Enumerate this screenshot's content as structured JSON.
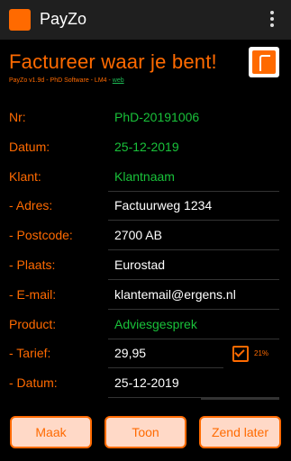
{
  "appbar": {
    "title": "PayZo"
  },
  "header": {
    "headline": "Factureer waar je bent!",
    "subline_prefix": "PayZo v1.9d - PhD Software - LM4 - ",
    "subline_link": "web"
  },
  "form": {
    "nr": {
      "label": "Nr:",
      "value": "PhD-20191006"
    },
    "datum": {
      "label": "Datum:",
      "value": "25-12-2019"
    },
    "klant": {
      "label": "Klant:",
      "value": "Klantnaam"
    },
    "adres": {
      "label": "- Adres:",
      "value": "Factuurweg 1234"
    },
    "postcode": {
      "label": "- Postcode:",
      "value": "2700 AB"
    },
    "plaats": {
      "label": "- Plaats:",
      "value": "Eurostad"
    },
    "email": {
      "label": "- E-mail:",
      "value": "klantemail@ergens.nl"
    },
    "product": {
      "label": "Product:",
      "value": "Adviesgesprek"
    },
    "tarief": {
      "label": "- Tarief:",
      "value": "29,95",
      "vat_label": "21%"
    },
    "datum2": {
      "label": "- Datum:",
      "value": "25-12-2019"
    }
  },
  "buttons": {
    "maak": "Maak",
    "toon": "Toon",
    "zend_later": "Zend later"
  },
  "colors": {
    "accent": "#ff6a00",
    "green": "#19c23a"
  }
}
